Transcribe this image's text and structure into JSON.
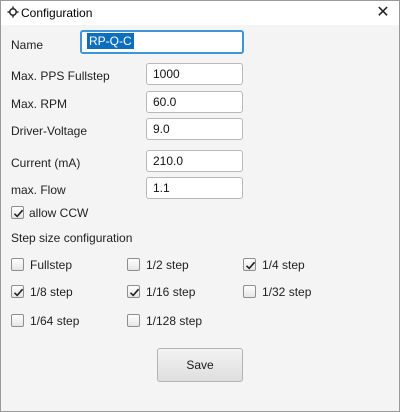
{
  "window": {
    "title": "Configuration",
    "close_glyph": "✕",
    "app_icon": "gear-icon"
  },
  "fields": [
    {
      "label": "Max. PPS Fullstep",
      "value": "1000"
    },
    {
      "label": "Max. RPM",
      "value": "60.0"
    },
    {
      "label": "Driver-Voltage",
      "value": "9.0"
    },
    {
      "label": "Current (mA)",
      "value": "210.0"
    },
    {
      "label": "max. Flow",
      "value": "1.1"
    }
  ],
  "name": {
    "label": "Name",
    "value": "RP-Q-C",
    "focused": true
  },
  "allow_ccw": {
    "label": "allow CCW",
    "checked": true
  },
  "step_section": {
    "title": "Step size configuration"
  },
  "steps": [
    {
      "label": "Fullstep",
      "checked": false
    },
    {
      "label": "1/2 step",
      "checked": false
    },
    {
      "label": "1/4 step",
      "checked": true
    },
    {
      "label": "1/8 step",
      "checked": true
    },
    {
      "label": "1/16 step",
      "checked": true
    },
    {
      "label": "1/32 step",
      "checked": false
    },
    {
      "label": "1/64 step",
      "checked": false
    },
    {
      "label": "1/128 step",
      "checked": false
    }
  ],
  "save_button": {
    "label": "Save"
  }
}
